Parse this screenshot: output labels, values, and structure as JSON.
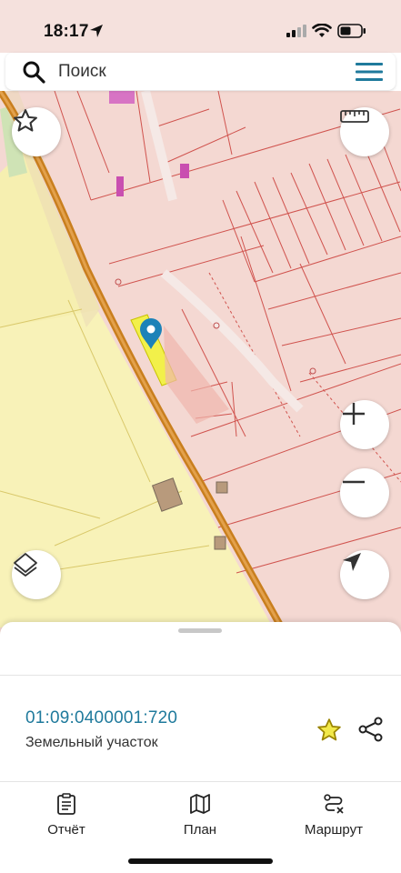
{
  "status": {
    "time": "18:17"
  },
  "search": {
    "placeholder": "Поиск"
  },
  "parcel": {
    "cadastral_number": "01:09:0400001:720",
    "type": "Земельный участок"
  },
  "bottom_nav": [
    {
      "label": "Отчёт",
      "icon": "report-icon"
    },
    {
      "label": "План",
      "icon": "map-icon"
    },
    {
      "label": "Маршрут",
      "icon": "route-icon"
    }
  ],
  "colors": {
    "accent": "#1f7a9c",
    "road": "#c97f1e",
    "parcel_fill": "#f4d8d2",
    "parcel_line": "#d0534e",
    "farmland": "#f8f2b8",
    "selected_parcel": "#f2f04a",
    "favorite_star": "#c9a800"
  },
  "icons": {
    "favorites": "star-icon",
    "ruler": "ruler-icon",
    "zoom_in": "plus-icon",
    "zoom_out": "minus-icon",
    "layers": "layers-icon",
    "locate": "navigation-arrow-icon",
    "marker": "map-pin-icon",
    "share": "share-icon"
  }
}
